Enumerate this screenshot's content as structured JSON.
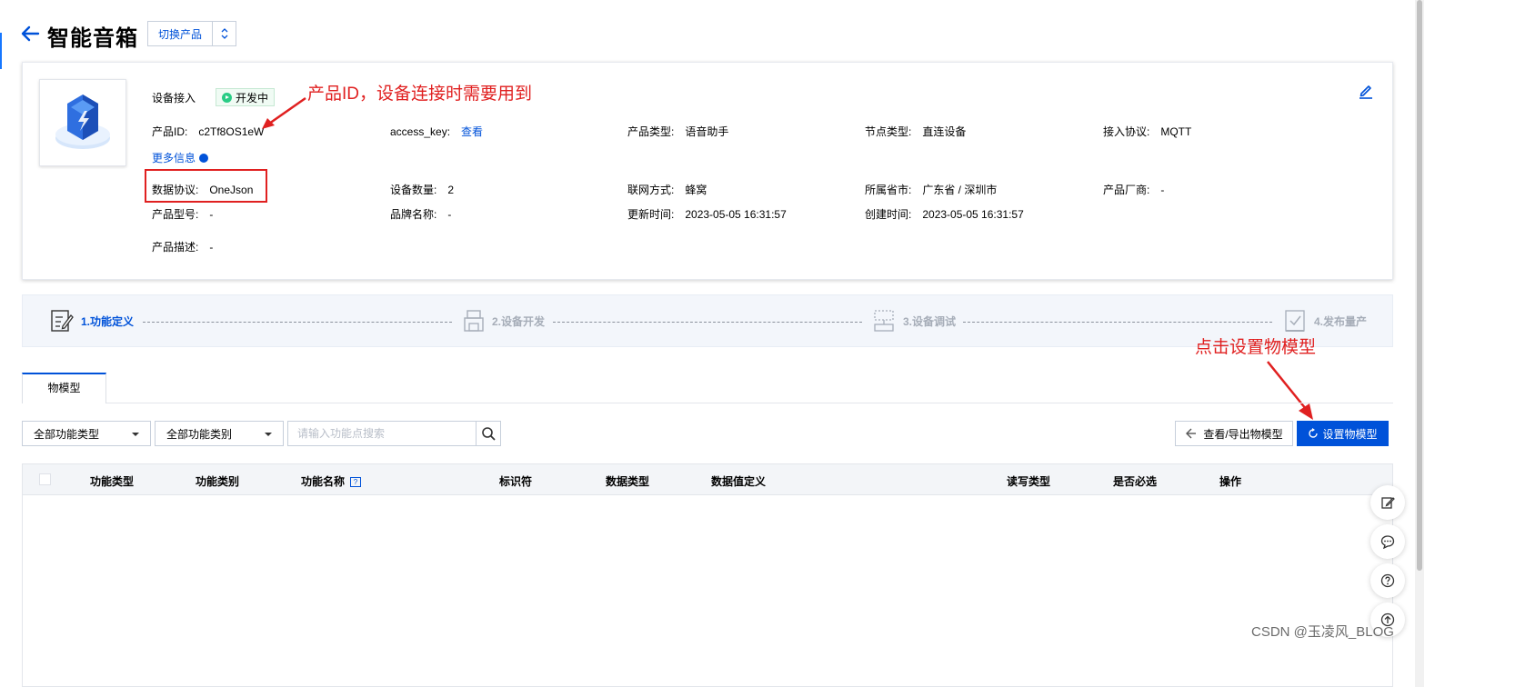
{
  "header": {
    "title": "智能音箱",
    "switch_label": "切换产品"
  },
  "card": {
    "section_title": "设备接入",
    "status": "开发中",
    "more_info": "更多信息",
    "fields": {
      "product_id": {
        "label": "产品ID:",
        "value": "c2Tf8OS1eW"
      },
      "access_key": {
        "label": "access_key:",
        "value": "查看"
      },
      "product_type": {
        "label": "产品类型:",
        "value": "语音助手"
      },
      "node_type": {
        "label": "节点类型:",
        "value": "直连设备"
      },
      "protocol": {
        "label": "接入协议:",
        "value": "MQTT"
      },
      "data_protocol": {
        "label": "数据协议:",
        "value": "OneJson"
      },
      "device_count": {
        "label": "设备数量:",
        "value": "2"
      },
      "network": {
        "label": "联网方式:",
        "value": "蜂窝"
      },
      "region": {
        "label": "所属省市:",
        "value": "广东省 / 深圳市"
      },
      "vendor": {
        "label": "产品厂商:",
        "value": "-"
      },
      "model": {
        "label": "产品型号:",
        "value": "-"
      },
      "brand": {
        "label": "品牌名称:",
        "value": "-"
      },
      "updated": {
        "label": "更新时间:",
        "value": "2023-05-05 16:31:57"
      },
      "created": {
        "label": "创建时间:",
        "value": "2023-05-05 16:31:57"
      },
      "description": {
        "label": "产品描述:",
        "value": "-"
      }
    }
  },
  "annotations": {
    "product_id_note": "产品ID，设备连接时需要用到",
    "set_model_note": "点击设置物模型"
  },
  "steps": [
    {
      "label": "1.功能定义",
      "active": true
    },
    {
      "label": "2.设备开发",
      "active": false
    },
    {
      "label": "3.设备调试",
      "active": false
    },
    {
      "label": "4.发布量产",
      "active": false
    }
  ],
  "tabs": {
    "active": "物模型"
  },
  "toolbar": {
    "type_select": "全部功能类型",
    "category_select": "全部功能类别",
    "search_placeholder": "请输入功能点搜索",
    "view_export": "查看/导出物模型",
    "set_model": "设置物模型"
  },
  "table": {
    "columns": [
      "功能类型",
      "功能类别",
      "功能名称",
      "标识符",
      "数据类型",
      "数据值定义",
      "读写类型",
      "是否必选",
      "操作"
    ],
    "help_glyph": "?"
  },
  "floating_tools": [
    "edit-icon",
    "chat-icon",
    "help-icon",
    "upload-icon"
  ],
  "watermark": "CSDN @玉凌风_BLOG",
  "colors": {
    "brand_blue": "#0052d9",
    "annotation_red": "#e02020",
    "status_green": "#29cc85"
  }
}
